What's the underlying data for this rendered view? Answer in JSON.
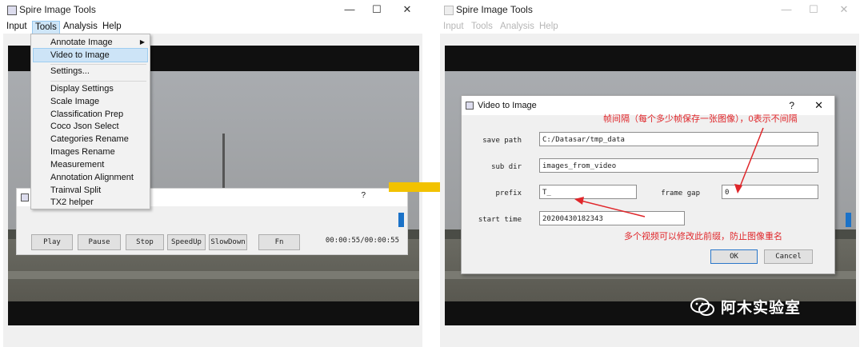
{
  "left_window": {
    "title": "Spire Image Tools",
    "menu": [
      "Input",
      "Tools",
      "Analysis",
      "Help"
    ],
    "tools_menu": {
      "items": [
        "Annotate Image",
        "Video to Image",
        "Settings...",
        "Display Settings",
        "Scale Image",
        "Classification Prep",
        "Coco Json Select",
        "Categories Rename",
        "Images Rename",
        "Measurement",
        "Annotation Alignment",
        "Trainval Split",
        "TX2 helper"
      ],
      "highlighted": "Video to Image"
    },
    "player": {
      "buttons": [
        "Play",
        "Pause",
        "Stop",
        "SpeedUp",
        "SlowDown",
        "Fn"
      ],
      "time": "00:00:55/00:00:55"
    }
  },
  "right_window": {
    "title": "Spire Image Tools",
    "menu": [
      "Input",
      "Tools",
      "Analysis",
      "Help"
    ],
    "dialog": {
      "title": "Video to Image",
      "help_glyph": "?",
      "fields": {
        "save_path": {
          "label": "save path",
          "value": "C:/Datasar/tmp_data"
        },
        "sub_dir": {
          "label": "sub dir",
          "value": "images_from_video"
        },
        "prefix": {
          "label": "prefix",
          "value": "T_"
        },
        "frame_gap": {
          "label": "frame gap",
          "value": "0"
        },
        "start_time": {
          "label": "start time",
          "value": "20200430182343"
        }
      },
      "ok_label": "OK",
      "cancel_label": "Cancel"
    },
    "annotations": {
      "frame_gap_note": "帧间隔（每个多少帧保存一张图像），0表示不间隔",
      "prefix_note": "多个视频可以修改此前缀，防止图像重名"
    }
  },
  "watermark": "阿木实验室",
  "colors": {
    "annotation": "#e0262a",
    "arrow": "#f2c200",
    "highlight": "#cde4f7",
    "accent": "#1b72c8"
  }
}
